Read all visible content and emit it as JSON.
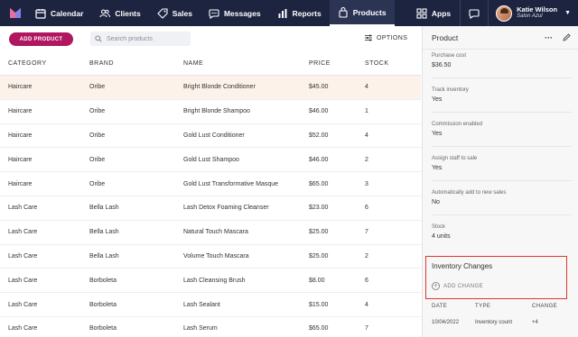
{
  "nav": {
    "items": [
      {
        "label": "Calendar",
        "icon": "calendar-icon"
      },
      {
        "label": "Clients",
        "icon": "clients-icon"
      },
      {
        "label": "Sales",
        "icon": "tag-icon"
      },
      {
        "label": "Messages",
        "icon": "message-icon"
      },
      {
        "label": "Reports",
        "icon": "bar-chart-icon"
      },
      {
        "label": "Products",
        "icon": "products-icon",
        "active": true
      }
    ],
    "apps_label": "Apps",
    "user": {
      "name": "Katie Wilson",
      "salon": "Salon Azul"
    }
  },
  "toolbar": {
    "add_label": "ADD PRODUCT",
    "search_placeholder": "Search products",
    "options_label": "OPTIONS"
  },
  "table": {
    "headers": [
      "CATEGORY",
      "BRAND",
      "NAME",
      "PRICE",
      "STOCK"
    ],
    "rows": [
      [
        "Haircare",
        "Oribe",
        "Bright Blonde Conditioner",
        "$45.00",
        "4"
      ],
      [
        "Haircare",
        "Oribe",
        "Bright Blonde Shampoo",
        "$46.00",
        "1"
      ],
      [
        "Haircare",
        "Oribe",
        "Gold Lust Conditioner",
        "$52.00",
        "4"
      ],
      [
        "Haircare",
        "Oribe",
        "Gold Lust Shampoo",
        "$46.00",
        "2"
      ],
      [
        "Haircare",
        "Oribe",
        "Gold Lust Transformative Masque",
        "$65.00",
        "3"
      ],
      [
        "Lash Care",
        "Bella Lash",
        "Lash Detox Foaming Cleanser",
        "$23.00",
        "6"
      ],
      [
        "Lash Care",
        "Bella Lash",
        "Natural Touch Mascara",
        "$25.00",
        "7"
      ],
      [
        "Lash Care",
        "Bella Lash",
        "Volume Touch Mascara",
        "$25.00",
        "2"
      ],
      [
        "Lash Care",
        "Borboleta",
        "Lash Cleansing Brush",
        "$8.00",
        "6"
      ],
      [
        "Lash Care",
        "Borboleta",
        "Lash Sealant",
        "$15.00",
        "4"
      ],
      [
        "Lash Care",
        "Borboleta",
        "Lash Serum",
        "$65.00",
        "7"
      ]
    ]
  },
  "panel": {
    "title": "Product",
    "fields": [
      {
        "label": "Purchase cost",
        "value": "$36.50"
      },
      {
        "label": "Track inventory",
        "value": "Yes"
      },
      {
        "label": "Commission enabled",
        "value": "Yes"
      },
      {
        "label": "Assign staff to sale",
        "value": "Yes"
      },
      {
        "label": "Automatically add to new sales",
        "value": "No"
      },
      {
        "label": "Stock",
        "value": "4 units"
      }
    ],
    "inventory": {
      "title": "Inventory Changes",
      "add_label": "ADD CHANGE",
      "headers": [
        "DATE",
        "TYPE",
        "CHANGE"
      ],
      "rows": [
        [
          "10/04/2022",
          "Inventory count",
          "+4"
        ]
      ]
    }
  },
  "colors": {
    "nav_bg": "#1c2440",
    "accent": "#b0175f",
    "highlight_border": "#d9382c",
    "selected_row": "#fcf2ea"
  }
}
